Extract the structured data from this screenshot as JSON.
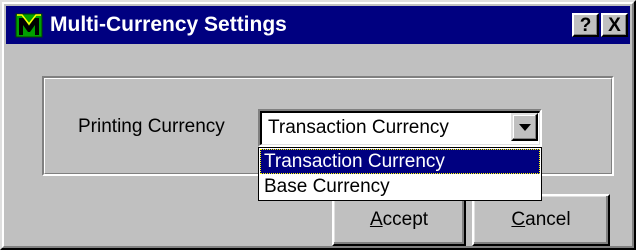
{
  "window": {
    "title": "Multi-Currency Settings",
    "help_button": "?",
    "close_button": "X",
    "app_icon": "mc-logo-icon"
  },
  "form": {
    "printing_currency_label": "Printing Currency",
    "selected_value": "Transaction Currency",
    "dropdown_open": true,
    "options": [
      "Transaction Currency",
      "Base Currency"
    ],
    "highlighted_option": "Transaction Currency"
  },
  "buttons": {
    "accept": {
      "mnemonic": "A",
      "rest": "ccept"
    },
    "cancel": {
      "mnemonic": "C",
      "rest": "ancel"
    }
  },
  "colors": {
    "titlebar": "#000080",
    "face": "#c0c0c0",
    "highlight": "#000080"
  }
}
